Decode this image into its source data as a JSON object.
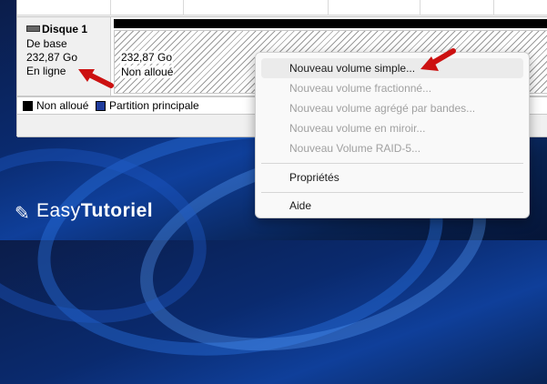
{
  "disk": {
    "name": "Disque 1",
    "type": "De base",
    "size": "232,87 Go",
    "status": "En ligne"
  },
  "volume": {
    "size": "232,87 Go",
    "label": "Non alloué"
  },
  "legend": [
    {
      "label": "Non alloué",
      "color": "#000000"
    },
    {
      "label": "Partition principale",
      "color": "#1f3c9c"
    }
  ],
  "menu": {
    "items": [
      {
        "label": "Nouveau volume simple...",
        "enabled": true
      },
      {
        "label": "Nouveau volume fractionné...",
        "enabled": false
      },
      {
        "label": "Nouveau volume agrégé par bandes...",
        "enabled": false
      },
      {
        "label": "Nouveau volume en miroir...",
        "enabled": false
      },
      {
        "label": "Nouveau Volume RAID-5...",
        "enabled": false
      },
      {
        "label": "Propriétés",
        "enabled": true
      },
      {
        "label": "Aide",
        "enabled": true
      }
    ]
  },
  "watermark": {
    "prefix": "Easy",
    "suffix": "Tutoriel"
  },
  "colors": {
    "arrow": "#cc1111",
    "menu_hover": "#ebebeb"
  }
}
